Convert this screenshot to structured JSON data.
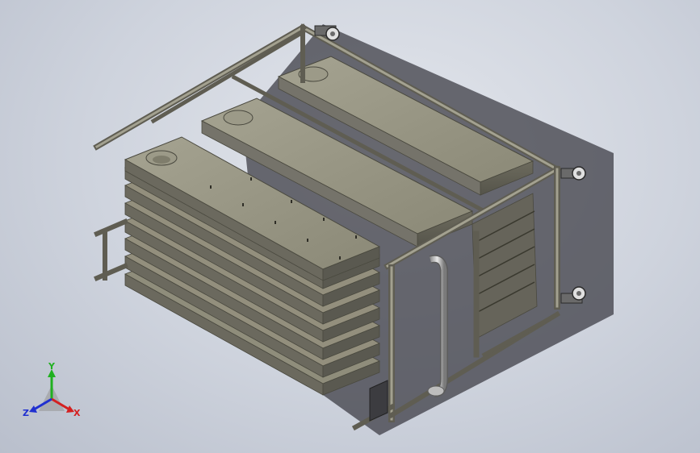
{
  "view": {
    "background_top": "#e3e6ec",
    "background_bottom": "#b9bfcc",
    "model_color": "#8d8a78",
    "model_shadow": "#3e3e46"
  },
  "triad": {
    "x_label": "X",
    "y_label": "Y",
    "z_label": "Z",
    "x_color": "#d42020",
    "y_color": "#20b020",
    "z_color": "#2030d0"
  }
}
